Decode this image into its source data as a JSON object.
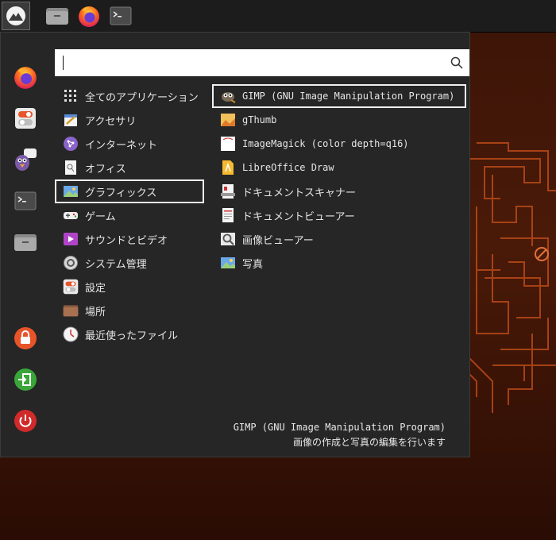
{
  "search": {
    "value": "",
    "placeholder": ""
  },
  "categories": [
    {
      "label": "全てのアプリケーション",
      "icon": "grid-icon"
    },
    {
      "label": "アクセサリ",
      "icon": "accessories-icon"
    },
    {
      "label": "インターネット",
      "icon": "internet-icon"
    },
    {
      "label": "オフィス",
      "icon": "office-icon"
    },
    {
      "label": "グラフィックス",
      "icon": "graphics-icon",
      "selected": true
    },
    {
      "label": "ゲーム",
      "icon": "gamepad-icon"
    },
    {
      "label": "サウンドとビデオ",
      "icon": "multimedia-icon"
    },
    {
      "label": "システム管理",
      "icon": "system-gear-icon"
    },
    {
      "label": "設定",
      "icon": "settings-toggle-icon"
    },
    {
      "label": "場所",
      "icon": "folder-icon"
    },
    {
      "label": "最近使ったファイル",
      "icon": "recent-clock-icon"
    }
  ],
  "apps": [
    {
      "label": "GIMP (GNU Image Manipulation Program)",
      "icon": "gimp-icon",
      "selected": true
    },
    {
      "label": "gThumb",
      "icon": "gthumb-icon"
    },
    {
      "label": "ImageMagick (color depth=q16)",
      "icon": "imagemagick-icon"
    },
    {
      "label": "LibreOffice Draw",
      "icon": "libreoffice-draw-icon"
    },
    {
      "label": "ドキュメントスキャナー",
      "icon": "scanner-icon"
    },
    {
      "label": "ドキュメントビューアー",
      "icon": "document-viewer-icon"
    },
    {
      "label": "画像ビューアー",
      "icon": "image-viewer-icon"
    },
    {
      "label": "写真",
      "icon": "photos-icon"
    }
  ],
  "description": {
    "name": "GIMP (GNU Image Manipulation Program)",
    "text": "画像の作成と写真の編集を行います"
  },
  "colors": {
    "accent_border": "#f0f0f0",
    "panel": "#1c1c1c",
    "menu_bg": "#262626"
  }
}
